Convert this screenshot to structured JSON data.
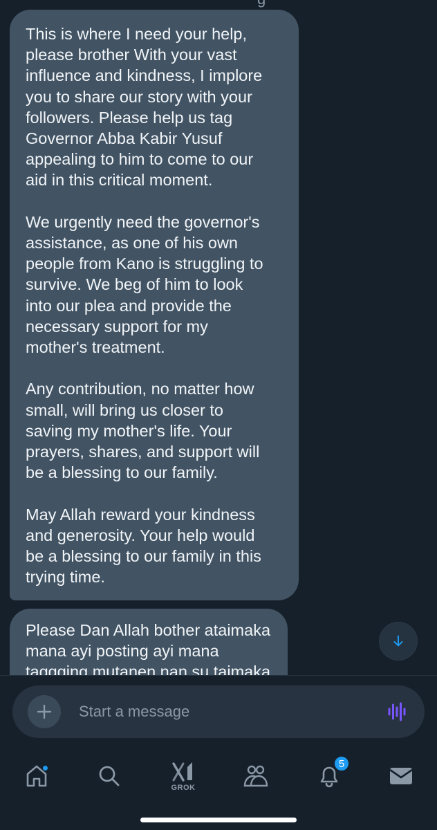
{
  "thread": {
    "top_cut_text": "g",
    "messages": [
      {
        "text": "This is where I need your help,\nplease brother With your vast\ninfluence and kindness, I implore\nyou to share our story with your\nfollowers. Please help us tag\nGovernor Abba Kabir Yusuf\nappealing to him to come to our\naid in this critical moment.\n\nWe urgently need the governor's\nassistance, as one of his own\npeople from Kano is struggling to\nsurvive. We beg of him to look\ninto our plea and provide the\nnecessary support for my\nmother's treatment.\n\nAny contribution, no matter how\nsmall, will bring us closer to\nsaving my mother's life. Your\nprayers, shares, and support will\nbe a blessing to our family.\n\nMay Allah reward your kindness\nand generosity. Your help would\nbe a blessing to our family in this\ntrying time."
      },
      {
        "text": "Please Dan Allah bother ataimaka\nmana ayi posting ayi mana\ntaggging mutanen nan su taimaka"
      }
    ],
    "scroll_down_icon": "arrow-down-icon"
  },
  "composer": {
    "placeholder": "Start a message",
    "value": "",
    "attach_icon": "plus-icon",
    "voice_icon": "voice-wave-icon"
  },
  "bottom_nav": {
    "items": [
      {
        "name": "home",
        "icon": "home-icon",
        "has_dot": true
      },
      {
        "name": "search",
        "icon": "search-icon"
      },
      {
        "name": "grok",
        "icon": "grok-icon",
        "label": "GROK"
      },
      {
        "name": "communities",
        "icon": "communities-icon"
      },
      {
        "name": "notifications",
        "icon": "bell-icon",
        "badge": "5"
      },
      {
        "name": "messages",
        "icon": "mail-icon"
      }
    ]
  },
  "colors": {
    "background": "#15202b",
    "bubble": "#425464",
    "accent": "#1d9bf0",
    "voice": "#7856ff"
  }
}
